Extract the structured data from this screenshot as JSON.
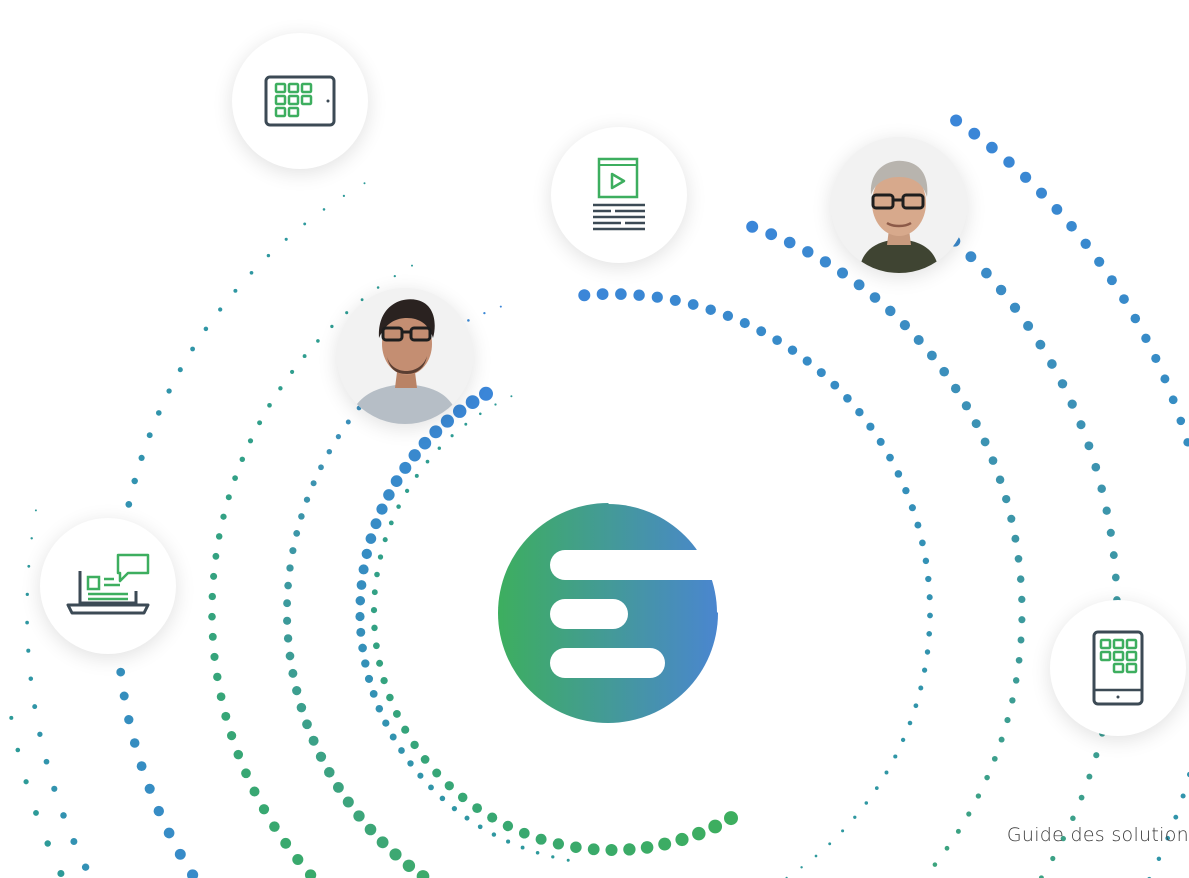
{
  "footer": {
    "label": "Guide des solution"
  },
  "bubbles": [
    {
      "name": "tablet-landscape-icon"
    },
    {
      "name": "video-document-icon"
    },
    {
      "name": "person-glasses-gray-hair"
    },
    {
      "name": "person-glasses-dark-hair"
    },
    {
      "name": "laptop-chat-icon"
    },
    {
      "name": "tablet-portrait-icon"
    }
  ],
  "colors": {
    "green": "#3dae5f",
    "teal": "#2d9a98",
    "blue": "#3b86d8",
    "icon_dark": "#3c4a55",
    "logo_start": "#3dae5f",
    "logo_end": "#4a86cf"
  }
}
